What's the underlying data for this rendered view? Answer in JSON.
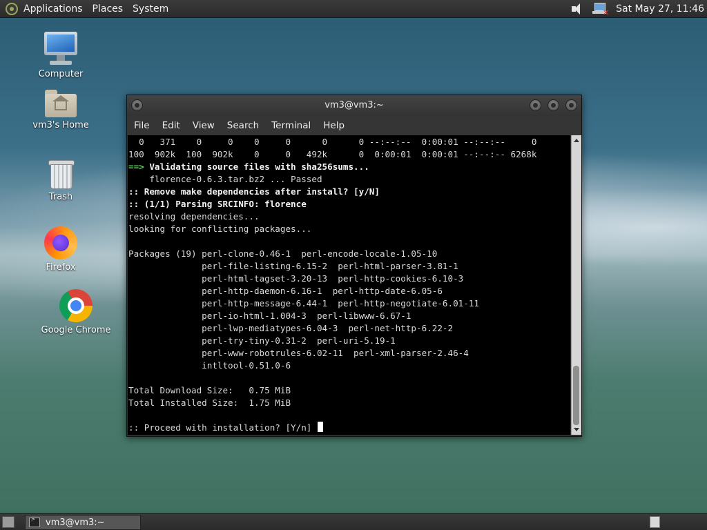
{
  "top_panel": {
    "menus": [
      "Applications",
      "Places",
      "System"
    ],
    "clock": "Sat May 27, 11:46",
    "icons": [
      "menu-logo-icon",
      "speaker-icon",
      "network-offline-icon"
    ]
  },
  "desktop_icons": [
    {
      "label": "Computer",
      "icon": "computer-icon"
    },
    {
      "label": "vm3's Home",
      "icon": "home-folder-icon"
    },
    {
      "label": "Trash",
      "icon": "trash-icon"
    },
    {
      "label": "Firefox",
      "icon": "firefox-icon"
    },
    {
      "label": "Google Chrome",
      "icon": "chrome-icon"
    }
  ],
  "terminal": {
    "title": "vm3@vm3:~",
    "menu": [
      "File",
      "Edit",
      "View",
      "Search",
      "Terminal",
      "Help"
    ],
    "lines": [
      {
        "text": "  0   371    0     0    0     0      0      0 --:--:--  0:00:01 --:--:--     0",
        "style": ""
      },
      {
        "text": "100  902k  100  902k    0     0   492k      0  0:00:01  0:00:01 --:--:-- 6268k",
        "style": ""
      },
      {
        "prefix": "==> ",
        "text": "Validating source files with sha256sums...",
        "style": "bold"
      },
      {
        "text": "    florence-0.6.3.tar.bz2 ... Passed",
        "style": ""
      },
      {
        "text": ":: Remove make dependencies after install? [y/N]",
        "style": "bold"
      },
      {
        "text": ":: (1/1) Parsing SRCINFO: florence",
        "style": "bold"
      },
      {
        "text": "resolving dependencies...",
        "style": ""
      },
      {
        "text": "looking for conflicting packages...",
        "style": ""
      },
      {
        "text": "",
        "style": ""
      },
      {
        "text": "Packages (19) perl-clone-0.46-1  perl-encode-locale-1.05-10",
        "style": ""
      },
      {
        "text": "              perl-file-listing-6.15-2  perl-html-parser-3.81-1",
        "style": ""
      },
      {
        "text": "              perl-html-tagset-3.20-13  perl-http-cookies-6.10-3",
        "style": ""
      },
      {
        "text": "              perl-http-daemon-6.16-1  perl-http-date-6.05-6",
        "style": ""
      },
      {
        "text": "              perl-http-message-6.44-1  perl-http-negotiate-6.01-11",
        "style": ""
      },
      {
        "text": "              perl-io-html-1.004-3  perl-libwww-6.67-1",
        "style": ""
      },
      {
        "text": "              perl-lwp-mediatypes-6.04-3  perl-net-http-6.22-2",
        "style": ""
      },
      {
        "text": "              perl-try-tiny-0.31-2  perl-uri-5.19-1",
        "style": ""
      },
      {
        "text": "              perl-www-robotrules-6.02-11  perl-xml-parser-2.46-4",
        "style": ""
      },
      {
        "text": "              intltool-0.51.0-6",
        "style": ""
      },
      {
        "text": "",
        "style": ""
      },
      {
        "text": "Total Download Size:   0.75 MiB",
        "style": ""
      },
      {
        "text": "Total Installed Size:  1.75 MiB",
        "style": ""
      },
      {
        "text": "",
        "style": ""
      },
      {
        "text": ":: Proceed with installation? [Y/n] ",
        "style": "",
        "cursor": true
      }
    ]
  },
  "taskbar": {
    "task_label": "vm3@vm3:~"
  },
  "colors": {
    "terminal_bg": "#000000",
    "terminal_fg": "#d9d9d9",
    "arrow_green": "#5fd35f",
    "panel_bg": "#2b2b2b"
  }
}
